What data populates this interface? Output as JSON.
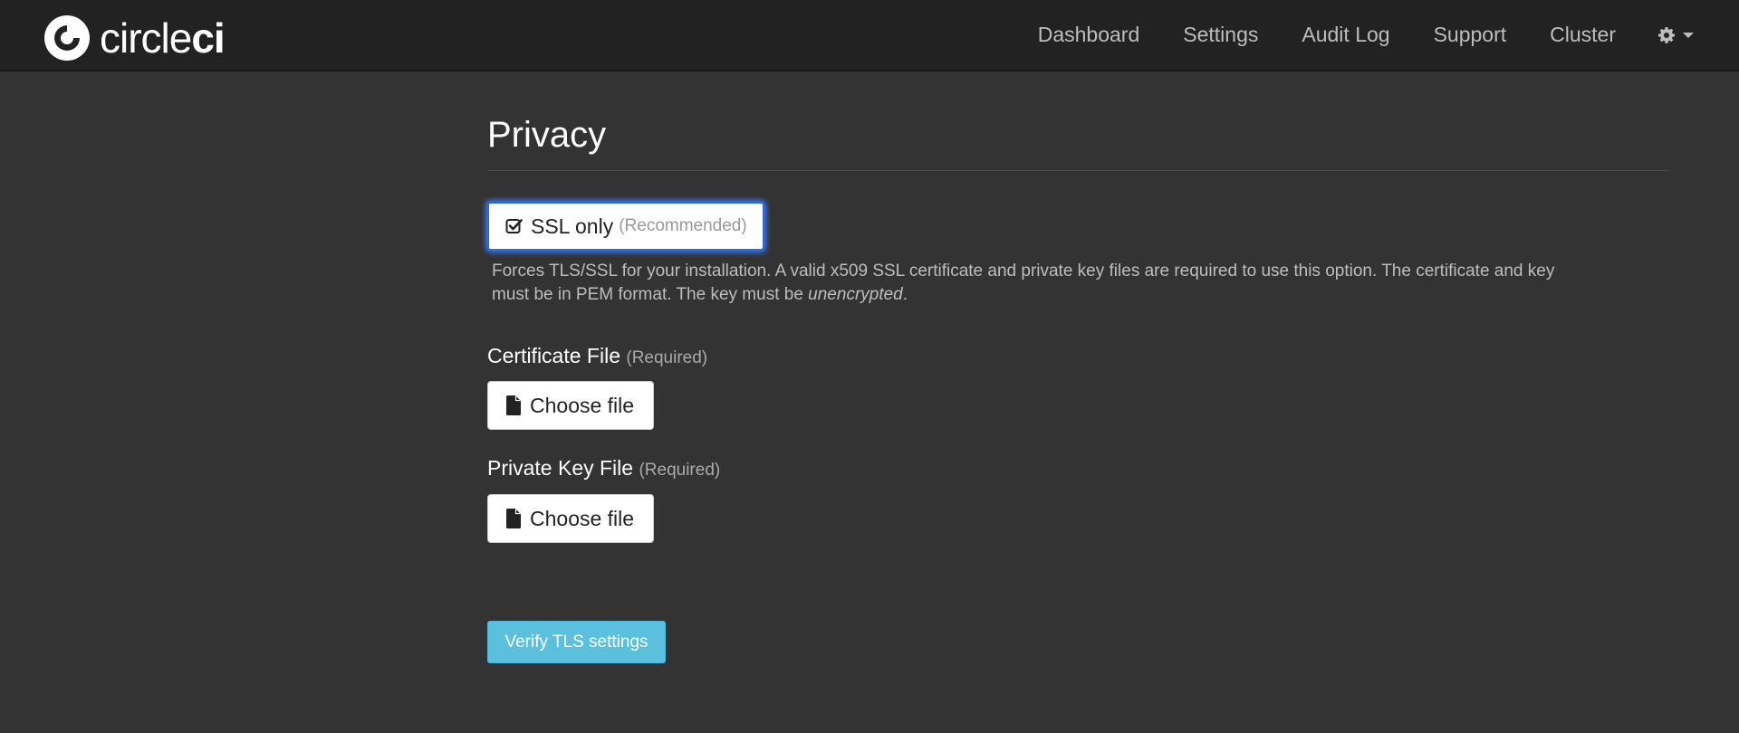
{
  "brand": {
    "logo_text_light": "circle",
    "logo_text_bold": "ci",
    "logo_icon": "circleci-logo-icon"
  },
  "nav": {
    "items": [
      {
        "label": "Dashboard"
      },
      {
        "label": "Settings"
      },
      {
        "label": "Audit Log"
      },
      {
        "label": "Support"
      },
      {
        "label": "Cluster"
      }
    ],
    "settings_icon": "gear-icon",
    "dropdown_icon": "caret-down-icon"
  },
  "privacy": {
    "title": "Privacy",
    "ssl_toggle": {
      "checked": true,
      "icon": "checkbox-checked-icon",
      "label": "SSL only",
      "hint": "(Recommended)"
    },
    "description_main": "Forces TLS/SSL for your installation. A valid x509 SSL certificate and private key files are required to use this option. The certificate and key must be in PEM format. The key must be ",
    "description_emphasis": "unencrypted",
    "description_end": ".",
    "certificate": {
      "label": "Certificate File",
      "required": "(Required)",
      "button_label": "Choose file",
      "icon": "file-icon"
    },
    "private_key": {
      "label": "Private Key File",
      "required": "(Required)",
      "button_label": "Choose file",
      "icon": "file-icon"
    },
    "verify_button": "Verify TLS settings"
  },
  "colors": {
    "background": "#333333",
    "topbar": "#222222",
    "accent_info": "#5bc0de",
    "focus_ring": "#2a6de0"
  }
}
